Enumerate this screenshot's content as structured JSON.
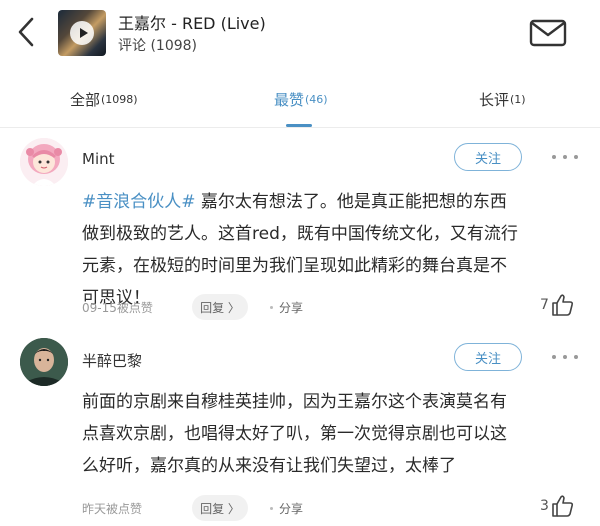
{
  "header": {
    "song_title": "王嘉尔 - RED (Live)",
    "comment_count": "评论 (1098)"
  },
  "tabs": [
    {
      "label": "全部",
      "count": "(1098)",
      "active": false
    },
    {
      "label": "最赞",
      "count": "(46)",
      "active": true
    },
    {
      "label": "长评",
      "count": "(1)",
      "active": false
    }
  ],
  "comments": [
    {
      "username": "Mint",
      "follow_label": "关注",
      "hashtag": "#音浪合伙人#",
      "text": " 嘉尔太有想法了。他是真正能把想的东西做到极致的艺人。这首red，既有中国传统文化，又有流行元素，在极短的时间里为我们呈现如此精彩的舞台真是不可思议！",
      "meta": "09-15被点赞",
      "reply_label": "回复 〉",
      "share_label": "分享",
      "likes": "7"
    },
    {
      "username": "半醉巴黎",
      "follow_label": "关注",
      "hashtag": "",
      "text": "前面的京剧来自穆桂英挂帅，因为王嘉尔这个表演莫名有点喜欢京剧，也唱得太好了叭，第一次觉得京剧也可以这么好听，嘉尔真的从来没有让我们失望过，太棒了",
      "meta": "昨天被点赞",
      "reply_label": "回复 〉",
      "share_label": "分享",
      "likes": "3"
    }
  ],
  "colors": {
    "accent": "#4a90c4",
    "text": "#2a2a2a",
    "muted": "#999999"
  }
}
